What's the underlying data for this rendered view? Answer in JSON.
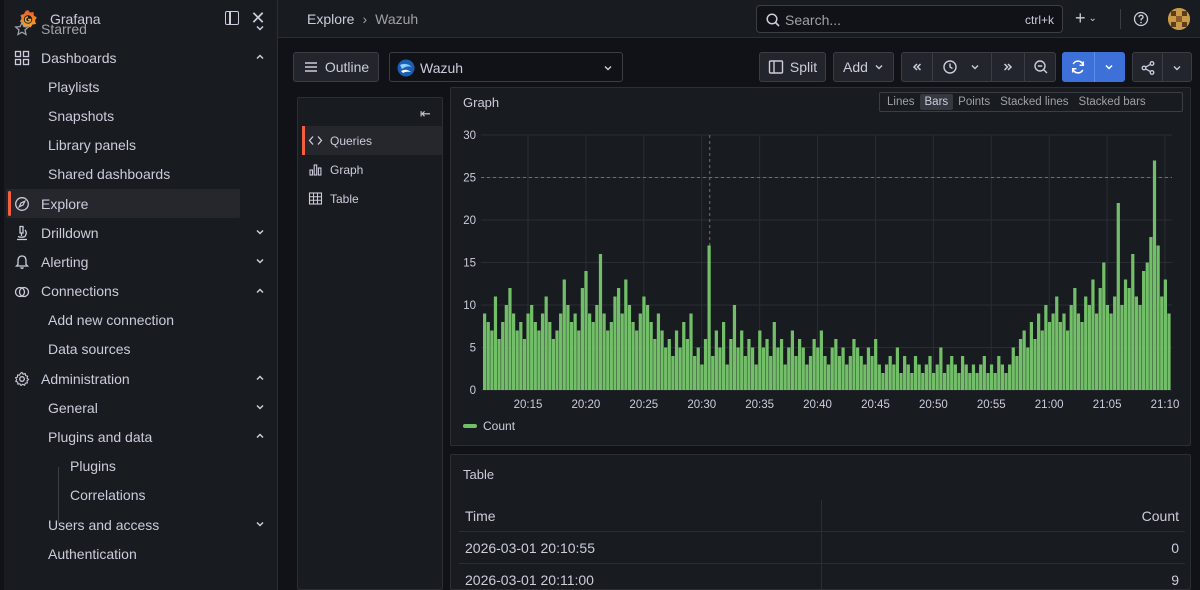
{
  "brand": {
    "name": "Grafana"
  },
  "sidebar": {
    "items": [
      {
        "label": "Starred",
        "icon": "star-icon",
        "chev": "down"
      },
      {
        "label": "Dashboards",
        "icon": "grid-icon",
        "chev": "up"
      },
      {
        "label": "Playlists",
        "level": 1
      },
      {
        "label": "Snapshots",
        "level": 1
      },
      {
        "label": "Library panels",
        "level": 1
      },
      {
        "label": "Shared dashboards",
        "level": 1
      },
      {
        "label": "Explore",
        "icon": "compass-icon",
        "active": true
      },
      {
        "label": "Drilldown",
        "icon": "microscope-icon",
        "chev": "down"
      },
      {
        "label": "Alerting",
        "icon": "bell-icon",
        "chev": "down"
      },
      {
        "label": "Connections",
        "icon": "link-icon",
        "chev": "up"
      },
      {
        "label": "Add new connection",
        "level": 1
      },
      {
        "label": "Data sources",
        "level": 1
      },
      {
        "label": "Administration",
        "icon": "cog-icon",
        "chev": "up"
      },
      {
        "label": "General",
        "level": 1,
        "chev": "down"
      },
      {
        "label": "Plugins and data",
        "level": 1,
        "chev": "up"
      },
      {
        "label": "Plugins",
        "level": 2
      },
      {
        "label": "Correlations",
        "level": 2
      },
      {
        "label": "Users and access",
        "level": 1,
        "chev": "down"
      },
      {
        "label": "Authentication",
        "level": 1
      }
    ]
  },
  "topbar": {
    "crumbs": [
      "Explore",
      "Wazuh"
    ],
    "search_placeholder": "Search...",
    "search_shortcut": "ctrl+k",
    "plus_label": "+"
  },
  "toolbar": {
    "outline_label": "Outline",
    "datasource": "Wazuh",
    "split_label": "Split",
    "add_label": "Add"
  },
  "outline": {
    "items": [
      {
        "label": "Queries",
        "icon": "code-icon",
        "active": true
      },
      {
        "label": "Graph",
        "icon": "bar-chart-icon"
      },
      {
        "label": "Table",
        "icon": "table-icon"
      }
    ]
  },
  "graph": {
    "title": "Graph",
    "modes": [
      "Lines",
      "Bars",
      "Points",
      "Stacked lines",
      "Stacked bars"
    ],
    "selected_mode": "Bars",
    "series_color": "#73bf69"
  },
  "chart_data": {
    "type": "bar",
    "title": "Graph",
    "ylim": [
      0,
      30
    ],
    "y_ticks": [
      0,
      5,
      10,
      15,
      20,
      25,
      30
    ],
    "x_ticks": [
      "20:15",
      "20:20",
      "20:25",
      "20:30",
      "20:35",
      "20:40",
      "20:45",
      "20:50",
      "20:55",
      "21:00",
      "21:05",
      "21:10"
    ],
    "grid": true,
    "legend_placement": "bottom-left",
    "series": [
      {
        "name": "Count",
        "values": [
          9,
          8,
          7,
          11,
          6,
          8,
          10,
          12,
          9,
          7,
          8,
          6,
          9,
          10,
          8,
          7,
          9,
          11,
          8,
          6,
          7,
          9,
          13,
          10,
          8,
          9,
          7,
          12,
          14,
          9,
          8,
          10,
          16,
          9,
          7,
          8,
          11,
          12,
          9,
          13,
          10,
          8,
          7,
          9,
          11,
          10,
          8,
          6,
          9,
          7,
          5,
          6,
          4,
          7,
          5,
          8,
          6,
          9,
          4,
          5,
          3,
          6,
          17,
          4,
          7,
          5,
          8,
          3,
          6,
          10,
          5,
          7,
          4,
          6,
          5,
          3,
          7,
          5,
          6,
          4,
          8,
          5,
          6,
          3,
          5,
          7,
          4,
          6,
          5,
          3,
          4,
          6,
          5,
          7,
          4,
          3,
          5,
          6,
          4,
          5,
          3,
          4,
          6,
          5,
          4,
          3,
          5,
          4,
          6,
          3,
          2,
          3,
          4,
          3,
          5,
          2,
          4,
          3,
          2,
          4,
          3,
          2,
          3,
          4,
          2,
          3,
          5,
          2,
          3,
          4,
          3,
          2,
          4,
          3,
          2,
          3,
          2,
          3,
          4,
          2,
          3,
          2,
          4,
          3,
          2,
          3,
          5,
          4,
          6,
          7,
          5,
          8,
          6,
          9,
          7,
          10,
          8,
          9,
          11,
          8,
          9,
          7,
          10,
          12,
          9,
          8,
          11,
          10,
          13,
          9,
          12,
          15,
          10,
          9,
          11,
          22,
          10,
          13,
          12,
          16,
          11,
          10,
          14,
          15,
          18,
          27,
          17,
          11,
          13,
          9
        ]
      }
    ]
  },
  "table": {
    "title": "Table",
    "columns": [
      "Time",
      "Count"
    ],
    "rows": [
      [
        "2026-03-01 20:10:55",
        "0"
      ],
      [
        "2026-03-01 20:11:00",
        "9"
      ]
    ]
  },
  "colors": {
    "accent": "#f55f3e",
    "primary": "#3d71d9",
    "series": "#73bf69"
  }
}
